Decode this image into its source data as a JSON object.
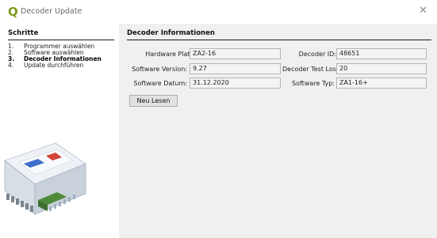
{
  "window": {
    "logo": "Q",
    "title": "Decoder Update",
    "close": "✕"
  },
  "sidebar": {
    "title": "Schritte",
    "steps": [
      {
        "num": "1.",
        "label": "Programmer auswählen",
        "active": false
      },
      {
        "num": "2.",
        "label": "Software auswählen",
        "active": false
      },
      {
        "num": "3.",
        "label": "Decoder Informationen",
        "active": true
      },
      {
        "num": "4.",
        "label": "Update durchführen",
        "active": false
      }
    ],
    "image_icon": "decoder-device-image"
  },
  "main": {
    "title": "Decoder Informationen",
    "fields": {
      "hardware_plattform": {
        "label": "Hardware Plattform:",
        "value": "ZA2-16"
      },
      "decoder_id": {
        "label": "Decoder ID:",
        "value": "48651"
      },
      "software_version": {
        "label": "Software Version:",
        "value": "9.27"
      },
      "decoder_test_los": {
        "label": "Decoder Test Los:",
        "value": "20"
      },
      "software_datum": {
        "label": "Software Datum:",
        "value": "31.12.2020"
      },
      "software_typ": {
        "label": "Software Typ:",
        "value": "ZA1-16+"
      }
    },
    "reload_button": "Neu Lesen"
  },
  "colors": {
    "logo_green": "#7a9a1c",
    "panel_bg": "#f0f0f0",
    "input_bg": "#f4f4f4"
  }
}
